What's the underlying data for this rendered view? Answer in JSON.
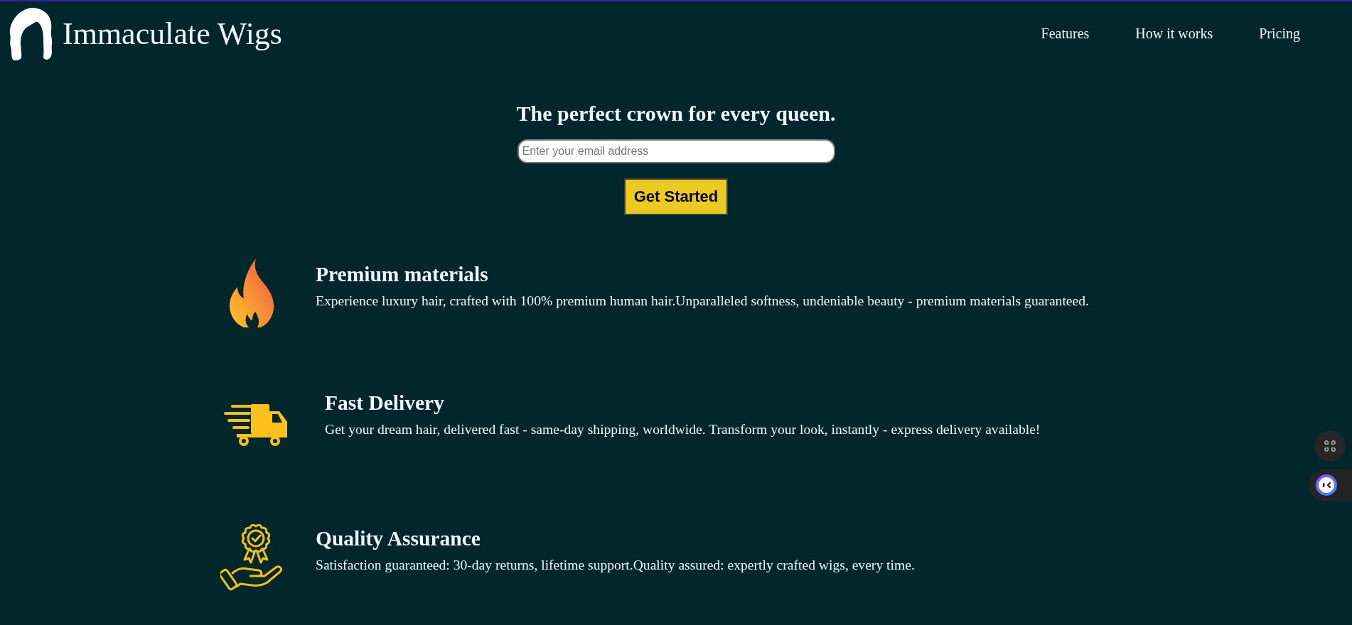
{
  "brand": {
    "name": "Immaculate Wigs"
  },
  "nav": [
    {
      "label": "Features"
    },
    {
      "label": "How it works"
    },
    {
      "label": "Pricing"
    }
  ],
  "hero": {
    "heading": "The perfect crown for every queen.",
    "email": {
      "placeholder": "Enter your email address"
    },
    "button": "Get Started"
  },
  "features": [
    {
      "kind": "fire",
      "title": "Premium materials",
      "text": "Experience luxury hair, crafted with 100% premium human hair.Unparalleled softness, undeniable beauty - premium materials guaranteed."
    },
    {
      "kind": "truck",
      "title": "Fast Delivery",
      "text": "Get your dream hair, delivered fast - same-day shipping, worldwide. Transform your look, instantly - express delivery available!"
    },
    {
      "kind": "award",
      "title": "Quality Assurance",
      "text": "Satisfaction guaranteed: 30-day returns, lifetime support.Quality assured: expertly crafted wigs, every time."
    }
  ]
}
